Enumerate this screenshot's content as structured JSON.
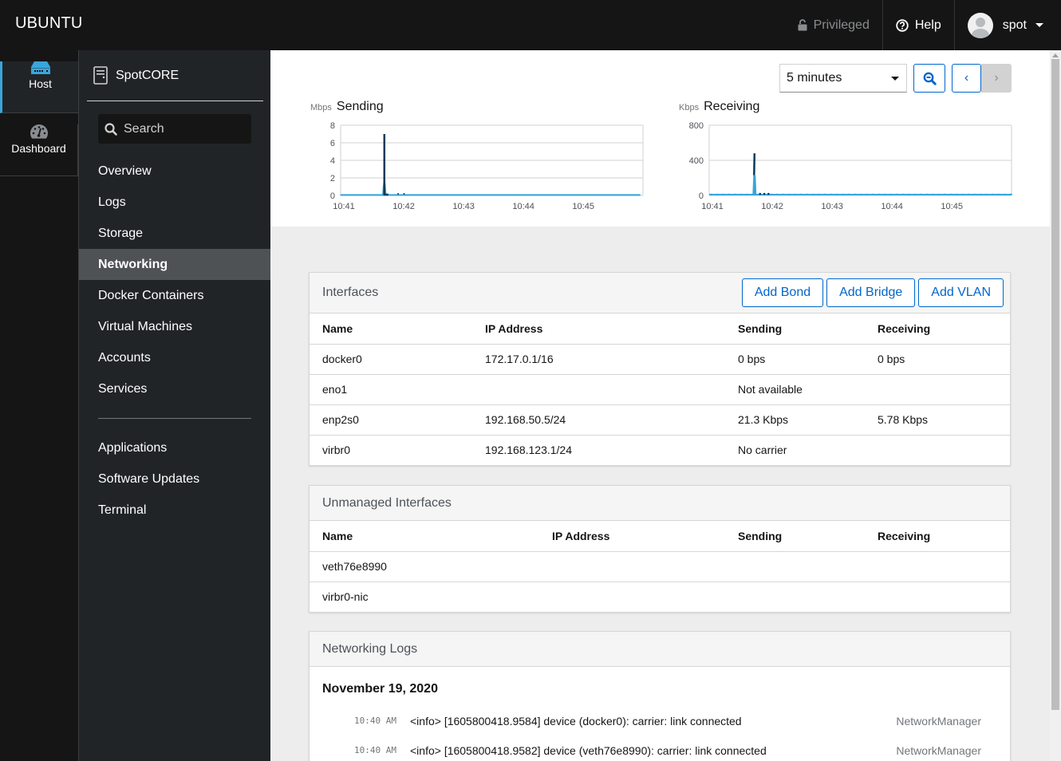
{
  "topbar": {
    "brand": "UBUNTU",
    "privileged": "Privileged",
    "help": "Help",
    "user": "spot"
  },
  "rail": [
    {
      "label": "Host",
      "icon": "server-icon",
      "active": true
    },
    {
      "label": "Dashboard",
      "icon": "dashboard-gauge-icon",
      "active": false
    }
  ],
  "sidebar": {
    "host_name": "SpotCORE",
    "search_placeholder": "Search",
    "items": [
      {
        "label": "Overview"
      },
      {
        "label": "Logs"
      },
      {
        "label": "Storage"
      },
      {
        "label": "Networking",
        "active": true
      },
      {
        "label": "Docker Containers"
      },
      {
        "label": "Virtual Machines"
      },
      {
        "label": "Accounts"
      },
      {
        "label": "Services"
      }
    ],
    "tools": [
      {
        "label": "Applications"
      },
      {
        "label": "Software Updates"
      },
      {
        "label": "Terminal"
      }
    ]
  },
  "toolbar": {
    "range": "5 minutes",
    "zoom_icon": "zoom-out-icon",
    "prev": "‹",
    "next": "›"
  },
  "chart_data": [
    {
      "type": "area",
      "title": "Sending",
      "unit": "Mbps",
      "ylim": [
        0,
        8
      ],
      "yticks": [
        "0",
        "2",
        "4",
        "6",
        "8"
      ],
      "xticks": [
        "10:41",
        "10:42",
        "10:43",
        "10:44",
        "10:45"
      ],
      "grid": true,
      "x_minutes": [
        0,
        0.7,
        0.73,
        0.76,
        0.8,
        1.0,
        5.0
      ],
      "series": [
        {
          "name": "total",
          "color": "#39a5dc",
          "values": [
            0.1,
            0.1,
            2.3,
            0.1,
            0.1,
            0.1,
            0.1
          ]
        },
        {
          "name": "top",
          "color": "#003d5c",
          "values": [
            0,
            0,
            7.0,
            0.1,
            0,
            0,
            0
          ]
        }
      ]
    },
    {
      "type": "area",
      "title": "Receiving",
      "unit": "Kbps",
      "ylim": [
        0,
        800
      ],
      "yticks": [
        "0",
        "400",
        "800"
      ],
      "xticks": [
        "10:41",
        "10:42",
        "10:43",
        "10:44",
        "10:45"
      ],
      "grid": true,
      "baseline_ripple": 20,
      "spike": {
        "x_minutes": 0.75,
        "light": 230,
        "dark": 480
      },
      "series": [
        {
          "name": "total",
          "color": "#39a5dc"
        },
        {
          "name": "top",
          "color": "#003d5c"
        }
      ]
    }
  ],
  "interfaces": {
    "title": "Interfaces",
    "actions": [
      "Add Bond",
      "Add Bridge",
      "Add VLAN"
    ],
    "columns": [
      "Name",
      "IP Address",
      "Sending",
      "Receiving"
    ],
    "rows": [
      {
        "name": "docker0",
        "ip": "172.17.0.1/16",
        "sending": "0 bps",
        "receiving": "0 bps"
      },
      {
        "name": "eno1",
        "ip": "",
        "sending": "Not available",
        "receiving": ""
      },
      {
        "name": "enp2s0",
        "ip": "192.168.50.5/24",
        "sending": "21.3 Kbps",
        "receiving": "5.78 Kbps"
      },
      {
        "name": "virbr0",
        "ip": "192.168.123.1/24",
        "sending": "No carrier",
        "receiving": ""
      }
    ]
  },
  "unmanaged": {
    "title": "Unmanaged Interfaces",
    "columns": [
      "Name",
      "IP Address",
      "Sending",
      "Receiving"
    ],
    "rows": [
      {
        "name": "veth76e8990",
        "ip": "",
        "sending": "",
        "receiving": ""
      },
      {
        "name": "virbr0-nic",
        "ip": "",
        "sending": "",
        "receiving": ""
      }
    ]
  },
  "logs": {
    "title": "Networking Logs",
    "date": "November 19, 2020",
    "entries": [
      {
        "time": "10:40 AM",
        "message": "<info> [1605800418.9584] device (docker0): carrier: link connected",
        "source": "NetworkManager"
      },
      {
        "time": "10:40 AM",
        "message": "<info> [1605800418.9582] device (veth76e8990): carrier: link connected",
        "source": "NetworkManager"
      }
    ]
  }
}
